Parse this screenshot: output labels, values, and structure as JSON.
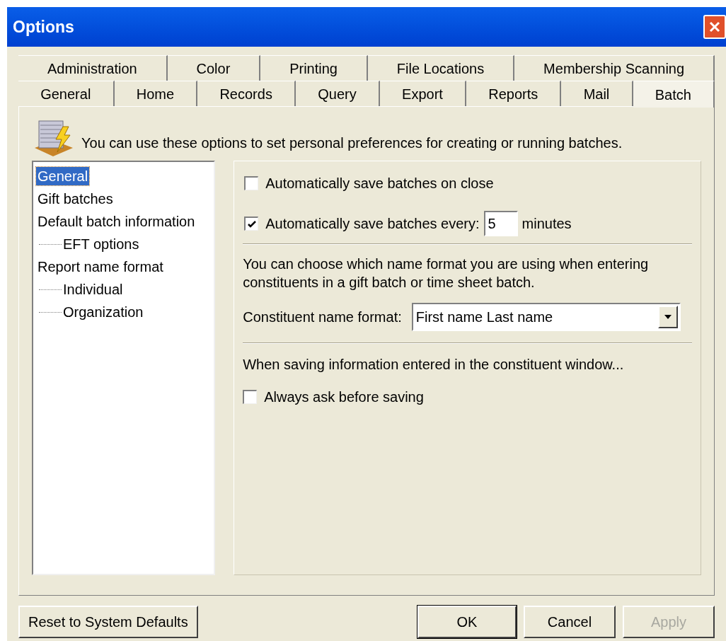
{
  "window": {
    "title": "Options"
  },
  "tab_rows": [
    [
      {
        "label": "Administration",
        "selected": false
      },
      {
        "label": "Color",
        "selected": false
      },
      {
        "label": "Printing",
        "selected": false
      },
      {
        "label": "File Locations",
        "selected": false
      },
      {
        "label": "Membership Scanning",
        "selected": false
      }
    ],
    [
      {
        "label": "General",
        "selected": false
      },
      {
        "label": "Home",
        "selected": false
      },
      {
        "label": "Records",
        "selected": false
      },
      {
        "label": "Query",
        "selected": false
      },
      {
        "label": "Export",
        "selected": false
      },
      {
        "label": "Reports",
        "selected": false
      },
      {
        "label": "Mail",
        "selected": false
      },
      {
        "label": "Batch",
        "selected": true
      }
    ]
  ],
  "intro": "You can use these options to set personal preferences for creating or running batches.",
  "tree": [
    {
      "label": "General",
      "selected": true
    },
    {
      "label": "Gift batches",
      "selected": false
    },
    {
      "label": "Default batch information",
      "selected": false,
      "children": [
        {
          "label": "EFT options",
          "selected": false
        }
      ]
    },
    {
      "label": "Report name format",
      "selected": false,
      "children": [
        {
          "label": "Individual",
          "selected": false
        },
        {
          "label": "Organization",
          "selected": false
        }
      ]
    }
  ],
  "settings": {
    "save_on_close": {
      "label": "Automatically save batches on close",
      "checked": false
    },
    "save_every": {
      "label": "Automatically save batches every:",
      "checked": true,
      "value": "5",
      "unit": "minutes"
    },
    "name_format_note": "You can choose which name format you are using when entering constituents in a gift batch or time sheet batch.",
    "name_format": {
      "label": "Constituent name format:",
      "value": "First name Last name"
    },
    "saving_note": "When saving information entered in the constituent window...",
    "always_ask": {
      "label": "Always ask before saving",
      "checked": false
    }
  },
  "buttons": [
    {
      "label": "Reset to System Defaults",
      "kind": "left",
      "disabled": false
    },
    {
      "label": "OK",
      "kind": "default",
      "disabled": false
    },
    {
      "label": "Cancel",
      "kind": "normal",
      "disabled": false
    },
    {
      "label": "Apply",
      "kind": "normal",
      "disabled": true
    }
  ]
}
